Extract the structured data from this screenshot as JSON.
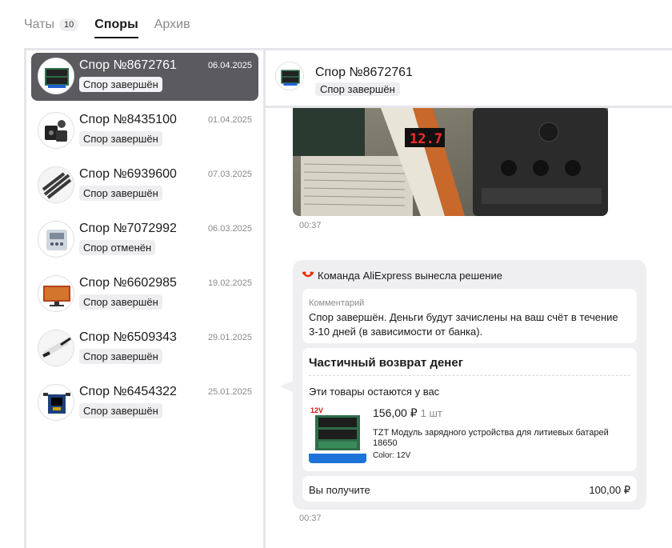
{
  "tabs": [
    {
      "label": "Чаты",
      "badge": "10"
    },
    {
      "label": "Споры"
    },
    {
      "label": "Архив"
    }
  ],
  "disputes": [
    {
      "title": "Спор №8672761",
      "date": "06.04.2025",
      "status": "Спор завершён",
      "icon": "charger-board-icon"
    },
    {
      "title": "Спор №8435100",
      "date": "01.04.2025",
      "status": "Спор завершён",
      "icon": "camera-box-icon"
    },
    {
      "title": "Спор №6939600",
      "date": "07.03.2025",
      "status": "Спор завершён",
      "icon": "cables-icon"
    },
    {
      "title": "Спор №7072992",
      "date": "06.03.2025",
      "status": "Спор отменён",
      "icon": "device-icon"
    },
    {
      "title": "Спор №6602985",
      "date": "19.02.2025",
      "status": "Спор завершён",
      "icon": "monitor-icon"
    },
    {
      "title": "Спор №6509343",
      "date": "29.01.2025",
      "status": "Спор завершён",
      "icon": "tool-icon"
    },
    {
      "title": "Спор №6454322",
      "date": "25.01.2025",
      "status": "Спор завершён",
      "icon": "board-icon"
    }
  ],
  "chat": {
    "title": "Спор №8672761",
    "status": "Спор завершён",
    "photo_time": "00:37",
    "photo_readout": "12.7",
    "decision": {
      "header": "Команда AliExpress вынесла решение",
      "comment_label": "Комментарий",
      "comment_text": "Спор завершён. Деньги будут зачислены на ваш счёт в течение 3-10 дней (в зависимости от банка).",
      "refund_title": "Частичный возврат денег",
      "remain_text": "Эти товары остаются у вас",
      "product": {
        "price": "156,00 ₽",
        "qty": "1 шт",
        "name": "TZT Модуль зарядного устройства для литиевых батарей 18650",
        "color": "Color: 12V",
        "badge": "12V"
      },
      "receive_label": "Вы получите",
      "receive_amount": "100,00 ₽"
    },
    "decision_time": "00:37"
  },
  "colors": {
    "selected_bg": "#5b5b5f",
    "brand": "#e62e04",
    "bubble": "#efeff2"
  }
}
